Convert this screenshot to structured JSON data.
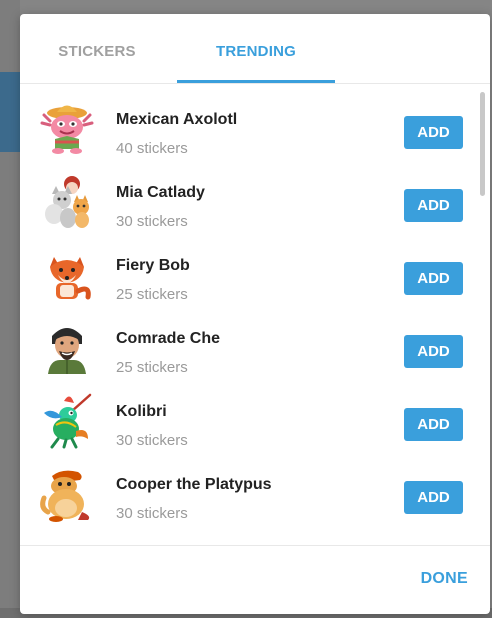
{
  "tabs": [
    {
      "label": "STICKERS",
      "active": false
    },
    {
      "label": "TRENDING",
      "active": true
    }
  ],
  "packs": [
    {
      "title": "Mexican Axolotl",
      "count": "40 stickers",
      "button": "ADD",
      "icon": "axolotl-sticker-icon"
    },
    {
      "title": "Mia Catlady",
      "count": "30 stickers",
      "button": "ADD",
      "icon": "catlady-sticker-icon"
    },
    {
      "title": "Fiery Bob",
      "count": "25 stickers",
      "button": "ADD",
      "icon": "fox-sticker-icon"
    },
    {
      "title": "Comrade Che",
      "count": "25 stickers",
      "button": "ADD",
      "icon": "che-sticker-icon"
    },
    {
      "title": "Kolibri",
      "count": "30 stickers",
      "button": "ADD",
      "icon": "hummingbird-sticker-icon"
    },
    {
      "title": "Cooper the Platypus",
      "count": "30 stickers",
      "button": "ADD",
      "icon": "platypus-sticker-icon"
    }
  ],
  "footer": {
    "done_label": "DONE"
  },
  "colors": {
    "accent": "#3a9fdc",
    "muted_text": "#9a9a9a",
    "title_text": "#222222"
  }
}
